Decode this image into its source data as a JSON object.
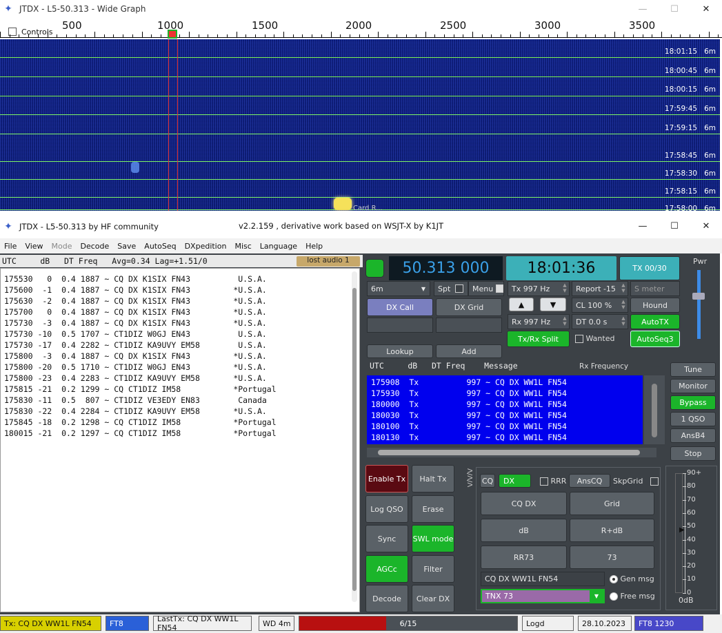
{
  "wg": {
    "title": "JTDX - L5-50.313 - Wide Graph",
    "controls": "Controls",
    "ticks": [
      "500",
      "1000",
      "1500",
      "2000",
      "2500",
      "3000",
      "3500"
    ],
    "times": [
      "18:01:15",
      "18:00:45",
      "18:00:15",
      "17:59:45",
      "17:59:15",
      "17:58:45",
      "17:58:30",
      "17:58:15",
      "17:58:00"
    ],
    "band": "6m",
    "card": "Card R..."
  },
  "main": {
    "title": "JTDX - L5-50.313  by HF community",
    "subtitle": "v2.2.159 , derivative work based on WSJT-X by K1JT"
  },
  "menu": [
    "File",
    "View",
    "Mode",
    "Decode",
    "Save",
    "AutoSeq",
    "DXpedition",
    "Misc",
    "Language",
    "Help"
  ],
  "band_activity": {
    "header": "UTC     dB   DT Freq   Avg=0.34 Lag=+1.51/0",
    "lost_audio": "lost audio 1",
    "rows": [
      "175530   0  0.4 1887 ~ CQ DX K1SIX FN43          U.S.A.",
      "175600  -1  0.4 1887 ~ CQ DX K1SIX FN43         *U.S.A.",
      "175630  -2  0.4 1887 ~ CQ DX K1SIX FN43         *U.S.A.",
      "175700   0  0.4 1887 ~ CQ DX K1SIX FN43         *U.S.A.",
      "175730  -3  0.4 1887 ~ CQ DX K1SIX FN43         *U.S.A.",
      "175730 -10  0.5 1707 ~ CT1DIZ W0GJ EN43          U.S.A.",
      "175730 -17  0.4 2282 ~ CT1DIZ KA9UVY EM58        U.S.A.",
      "175800  -3  0.4 1887 ~ CQ DX K1SIX FN43         *U.S.A.",
      "175800 -20  0.5 1710 ~ CT1DIZ W0GJ EN43         *U.S.A.",
      "175800 -23  0.4 2283 ~ CT1DIZ KA9UVY EM58       *U.S.A.",
      "175815 -21  0.2 1299 ~ CQ CT1DIZ IM58           *Portugal",
      "175830 -11  0.5  807 ~ CT1DIZ VE3EDY EN83        Canada",
      "175830 -22  0.4 2284 ~ CT1DIZ KA9UVY EM58       *U.S.A.",
      "175845 -18  0.2 1298 ~ CQ CT1DIZ IM58           *Portugal",
      "180015 -21  0.2 1297 ~ CQ CT1DIZ IM58           *Portugal"
    ]
  },
  "top": {
    "freq": "50.313 000",
    "time": "18:01:36",
    "tx_period": "TX 00/30",
    "pwr": "Pwr",
    "band": "6m",
    "spt": "Spt",
    "menu": "Menu",
    "tx_hz": "Tx  997 Hz",
    "report": "Report -15",
    "smeter": "S meter",
    "dx_call": "DX Call",
    "dx_grid": "DX Grid",
    "cl": "CL  100 %",
    "hound": "Hound",
    "rx_hz": "Rx  997 Hz",
    "dt": "DT 0.0 s",
    "autotx": "AutoTX",
    "txrx_split": "Tx/Rx Split",
    "wanted": "Wanted",
    "autoseq": "AutoSeq3",
    "lookup": "Lookup",
    "add": "Add",
    "up": "▲",
    "down": "▼"
  },
  "rx_freq": {
    "header": "UTC     dB   DT Freq    Message",
    "label": "Rx Frequency",
    "rows": [
      "175908  Tx          997 ~ CQ DX WW1L FN54",
      "175930  Tx          997 ~ CQ DX WW1L FN54",
      "180000  Tx          997 ~ CQ DX WW1L FN54",
      "180030  Tx          997 ~ CQ DX WW1L FN54",
      "180100  Tx          997 ~ CQ DX WW1L FN54",
      "180130  Tx          997 ~ CQ DX WW1L FN54"
    ]
  },
  "side": [
    "Tune",
    "Monitor",
    "Bypass",
    "1 QSO",
    "AnsB4",
    "Stop"
  ],
  "controls": {
    "enable_tx": "Enable Tx",
    "halt_tx": "Halt Tx",
    "log_qso": "Log QSO",
    "erase": "Erase",
    "sync": "Sync",
    "swl": "SWL mode",
    "agcc": "AGCc",
    "filter": "Filter",
    "decode": "Decode",
    "clear_dx": "Clear DX"
  },
  "msg": {
    "cq": "CQ",
    "dx": "DX",
    "rrr": "RRR",
    "anscq": "AnsCQ",
    "skpgrid": "SkpGrid",
    "cq_dx": "CQ DX",
    "grid": "Grid",
    "db": "dB",
    "r_db": "R+dB",
    "rr73": "RR73",
    "b73": "73",
    "gen_field": "CQ DX WW1L FN54",
    "gen_msg": "Gen msg",
    "tnx": "TNX 73",
    "free_msg": "Free msg",
    "vert": "Λ/Λ/Λ"
  },
  "meter": {
    "ticks": [
      "90+",
      "80",
      "70",
      "60",
      "50",
      "40",
      "30",
      "20",
      "10",
      "0"
    ],
    "label": "0dB",
    "level": 0.53
  },
  "status": {
    "tx": "Tx: CQ DX WW1L FN54",
    "mode": "FT8",
    "lasttx": "LastTx: CQ DX WW1L FN54",
    "wd": "WD 4m",
    "progress_text": "6/15",
    "progress": 0.4,
    "logd": "Logd",
    "date": "28.10.2023",
    "ft8": "FT8  1230"
  }
}
